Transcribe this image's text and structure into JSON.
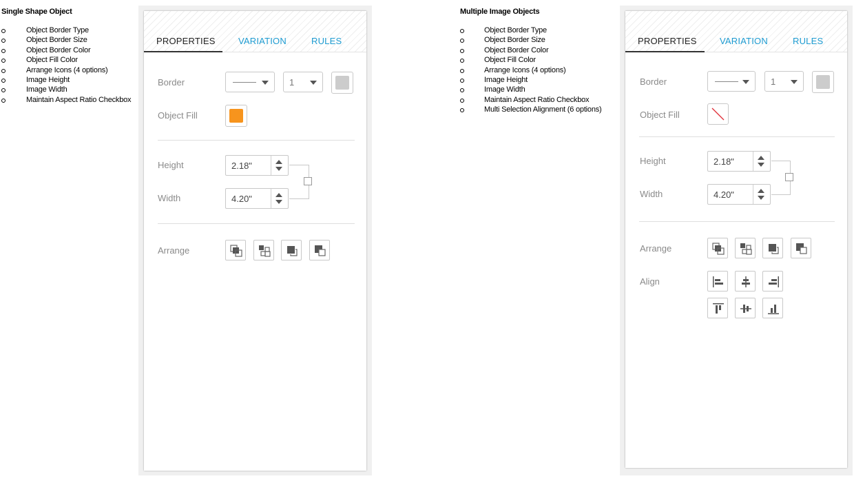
{
  "left_notes": {
    "title": "Single Shape Object",
    "items": [
      "Object Border Type",
      "Object Border Size",
      "Object Border Color",
      "Object Fill Color",
      "Arrange Icons (4 options)",
      "Image Height",
      "Image Width",
      "Maintain Aspect Ratio Checkbox"
    ]
  },
  "right_notes": {
    "title": "Multiple Image Objects",
    "items": [
      "Object Border Type",
      "Object Border Size",
      "Object Border Color",
      "Object Fill Color",
      "Arrange Icons (4 options)",
      "Image Height",
      "Image Width",
      "Maintain Aspect Ratio Checkbox",
      "Multi Selection Alignment (6 options)"
    ]
  },
  "panel1": {
    "tabs": [
      "PROPERTIES",
      "VARIATION",
      "RULES"
    ],
    "border_label": "Border",
    "border_size": "1",
    "object_fill_label": "Object Fill",
    "fill_color": "#f7941d",
    "border_color": "#cccccc",
    "height_label": "Height",
    "height_value": "2.18\"",
    "width_label": "Width",
    "width_value": "4.20\"",
    "arrange_label": "Arrange"
  },
  "panel2": {
    "tabs": [
      "PROPERTIES",
      "VARIATION",
      "RULES"
    ],
    "border_label": "Border",
    "border_size": "1",
    "object_fill_label": "Object Fill",
    "fill_color": "none",
    "border_color": "#cccccc",
    "height_label": "Height",
    "height_value": "2.18\"",
    "width_label": "Width",
    "width_value": "4.20\"",
    "arrange_label": "Arrange",
    "align_label": "Align"
  },
  "colors": {
    "tab_active": "#222222",
    "tab_inactive": "#1d9bd1",
    "label": "#8a8a8a",
    "fill_orange": "#f7941d",
    "no_fill_slash": "#e0303a"
  },
  "icons": {
    "arrange": [
      "bring-to-front-icon",
      "bring-forward-icon",
      "send-backward-icon",
      "send-to-back-icon"
    ],
    "align": [
      "align-left-icon",
      "align-center-horizontal-icon",
      "align-right-icon",
      "align-top-icon",
      "align-middle-vertical-icon",
      "align-bottom-icon"
    ]
  }
}
